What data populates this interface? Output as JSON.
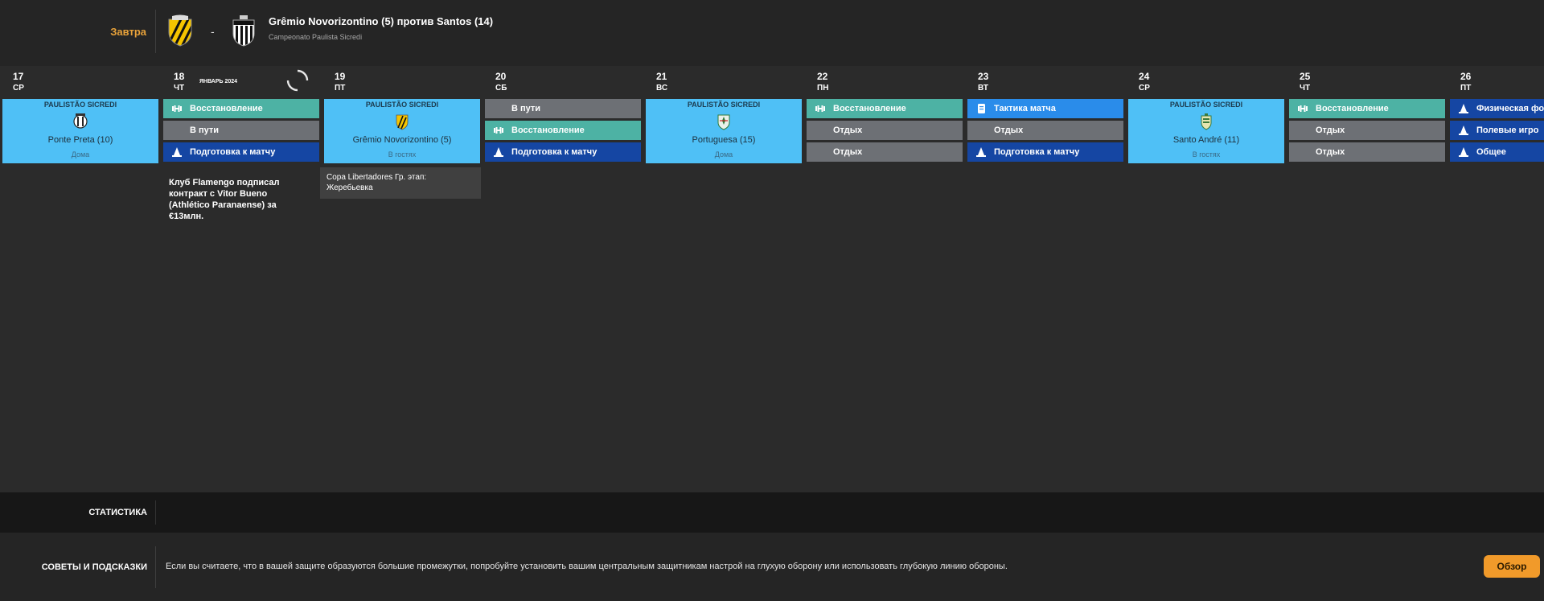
{
  "next_match": {
    "when": "Завтра",
    "separator": "-",
    "title": "Grêmio Novorizontino (5) против Santos (14)",
    "competition": "Campeonato Paulista Sicredi"
  },
  "calendar": {
    "month_label": "ЯНВАРЬ 2024",
    "days": [
      {
        "day": "17",
        "weekday": "СР",
        "match": {
          "competition": "PAULISTÃO SICREDI",
          "opponent": "Ponte Preta (10)",
          "venue": "Дома",
          "crest_icon": "ponte-preta-crest-icon"
        },
        "sessions": []
      },
      {
        "day": "18",
        "weekday": "ЧТ",
        "sessions": [
          {
            "label": "Восстановление",
            "type": "recovery",
            "icon": "dumbbell-icon"
          },
          {
            "label": "В пути",
            "type": "rest",
            "icon": ""
          },
          {
            "label": "Подготовка к матчу",
            "type": "prep",
            "icon": "cone-icon"
          }
        ],
        "news": "Клуб Flamengo подписал контракт с Vitor Bueno (Athlético Paranaense) за €13млн."
      },
      {
        "day": "19",
        "weekday": "ПТ",
        "match": {
          "competition": "PAULISTÃO SICREDI",
          "opponent": "Grêmio Novorizontino (5)",
          "venue": "В гостях",
          "crest_icon": "novorizontino-crest-icon"
        },
        "sessions": [],
        "event": "Copa Libertadores Гр. этап: Жеребьевка"
      },
      {
        "day": "20",
        "weekday": "СБ",
        "sessions": [
          {
            "label": "В пути",
            "type": "rest",
            "icon": ""
          },
          {
            "label": "Восстановление",
            "type": "recovery",
            "icon": "dumbbell-icon"
          },
          {
            "label": "Подготовка к матчу",
            "type": "prep",
            "icon": "cone-icon"
          }
        ]
      },
      {
        "day": "21",
        "weekday": "ВС",
        "match": {
          "competition": "PAULISTÃO SICREDI",
          "opponent": "Portuguesa (15)",
          "venue": "Дома",
          "crest_icon": "portuguesa-crest-icon"
        },
        "sessions": []
      },
      {
        "day": "22",
        "weekday": "ПН",
        "sessions": [
          {
            "label": "Восстановление",
            "type": "recovery",
            "icon": "dumbbell-icon"
          },
          {
            "label": "Отдых",
            "type": "rest",
            "icon": ""
          },
          {
            "label": "Отдых",
            "type": "rest",
            "icon": ""
          }
        ]
      },
      {
        "day": "23",
        "weekday": "ВТ",
        "sessions": [
          {
            "label": "Тактика матча",
            "type": "tactic",
            "icon": "clipboard-icon"
          },
          {
            "label": "Отдых",
            "type": "rest",
            "icon": ""
          },
          {
            "label": "Подготовка к матчу",
            "type": "prep",
            "icon": "cone-icon"
          }
        ]
      },
      {
        "day": "24",
        "weekday": "СР",
        "match": {
          "competition": "PAULISTÃO SICREDI",
          "opponent": "Santo André (11)",
          "venue": "В гостях",
          "crest_icon": "santo-andre-crest-icon"
        },
        "sessions": []
      },
      {
        "day": "25",
        "weekday": "ЧТ",
        "sessions": [
          {
            "label": "Восстановление",
            "type": "recovery",
            "icon": "dumbbell-icon"
          },
          {
            "label": "Отдых",
            "type": "rest",
            "icon": ""
          },
          {
            "label": "Отдых",
            "type": "rest",
            "icon": ""
          }
        ]
      },
      {
        "day": "26",
        "weekday": "ПТ",
        "sessions": [
          {
            "label": "Физическая фо",
            "type": "prep",
            "icon": "cone-icon"
          },
          {
            "label": "Полевые игро",
            "type": "prep",
            "icon": "cone-icon"
          },
          {
            "label": "Общее",
            "type": "prep",
            "icon": "cone-icon"
          }
        ]
      }
    ]
  },
  "stats": {
    "label": "СТАТИСТИКА"
  },
  "tips": {
    "label": "СОВЕТЫ И ПОДСКАЗКИ",
    "text": "Если вы считаете, что в вашей защите образуются большие промежутки, попробуйте установить вашим центральным защитникам настрой на глухую оборону или использовать глубокую линию обороны.",
    "button_label": "Обзор"
  },
  "colors": {
    "accent": "#f19a2a",
    "match_card": "#4fc0f6",
    "recovery": "#4db2a4",
    "rest": "#6d7075",
    "prep": "#1546a3",
    "tactic": "#2a8cea"
  }
}
